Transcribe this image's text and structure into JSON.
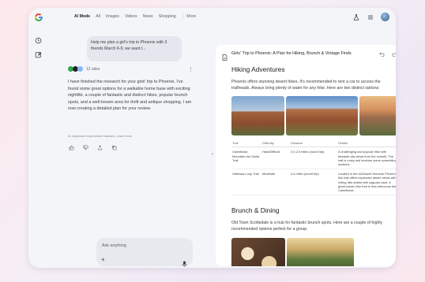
{
  "topbar": {
    "tabs": [
      "AI Mode",
      "All",
      "Images",
      "Videos",
      "News",
      "Shopping",
      "⋮ More"
    ]
  },
  "chat": {
    "user_message": "Help me plan a girl's trip to Phoenix with 3 friends March 6-9, we want t...",
    "sources_count": "12 sites",
    "answer": "I have finished the research for your girls' trip to Phoenix. I've found some great options for a walkable home base with exciting nightlife, a couple of fantastic and distinct hikes, popular brunch spots, and a well-known area for thrift and antique shopping. I am now creating a detailed plan for your review.",
    "disclaimer": "AI responses may include mistakes. Learn more",
    "ask_placeholder": "Ask anything"
  },
  "doc": {
    "title": "Girls' Trip to Phoenix: A Plan for Hiking, Brunch & Vintage Finds",
    "sections": {
      "hiking": {
        "heading": "Hiking Adventures",
        "intro": "Phoenix offers stunning desert hikes. It's recommended to rent a car to access the trailheads. Always bring plenty of water for any hike. Here are two distinct options:"
      },
      "brunch": {
        "heading": "Brunch & Dining",
        "intro": "Old Town Scottsdale is a hub for fantastic brunch spots. Here are a couple of highly recommended options perfect for a group."
      }
    },
    "table": {
      "headers": [
        "Trail",
        "Difficulty",
        "Distance",
        "Details"
      ],
      "rows": [
        [
          "Camelback Mountain via Cholla Trail",
          "Hard/Difficult",
          "2.0-2.5 miles (round trip)",
          "A challenging and popular hike with fantastic city views from the summit. The trail is rocky and involves some scrambling sections."
        ],
        [
          "Gateway Loop Trail",
          "Moderate",
          "4.4 miles (round trip)",
          "Located in the McDowell Sonoran Preserve, this trail offers expansive desert views with rolling hills dotted with saguaro cacti. A great scenic hike that is less strenuous than Camelback."
        ]
      ]
    }
  },
  "colors": {
    "accent_blue": "#4285f4",
    "window_bg": "#f3f5f9",
    "doc_bg": "#ffffff"
  },
  "icons": {
    "top_right": [
      "flask-icon",
      "menu-icon",
      "avatar"
    ],
    "siderail": [
      "history-icon",
      "new-chat-icon"
    ],
    "feedback": [
      "thumbs-up-icon",
      "thumbs-down-icon",
      "share-icon",
      "copy-icon"
    ],
    "doc_actions": [
      "undo-icon",
      "redo-icon",
      "export-icon"
    ]
  }
}
